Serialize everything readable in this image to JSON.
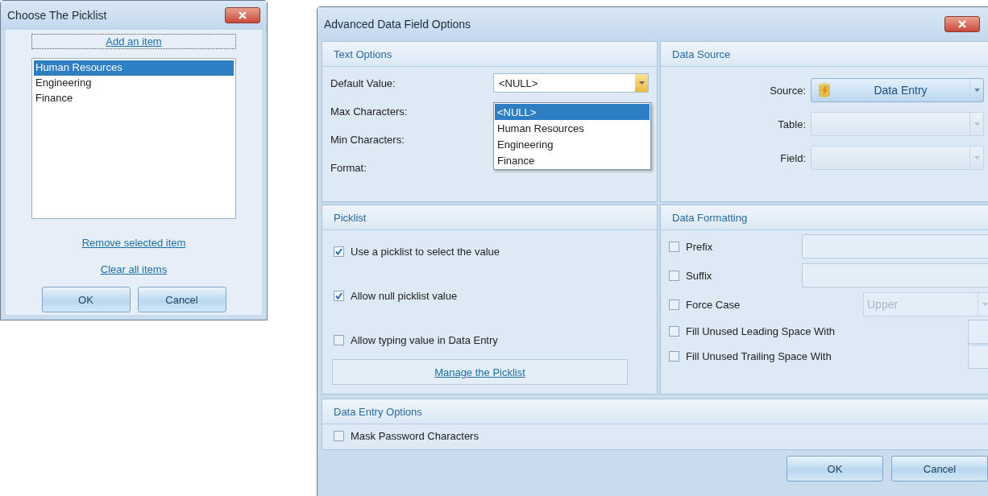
{
  "picklist_dialog": {
    "title": "Choose The Picklist",
    "add_link": "Add an item",
    "items": [
      {
        "label": "Human Resources",
        "selected": true
      },
      {
        "label": "Engineering",
        "selected": false
      },
      {
        "label": "Finance",
        "selected": false
      }
    ],
    "remove_link": "Remove selected item",
    "clear_link": "Clear all items",
    "buttons": [
      "OK",
      "Cancel"
    ]
  },
  "options_dialog": {
    "title": "Advanced Data Field Options",
    "text_options": {
      "heading": "Text Options",
      "default_label": "Default Value:",
      "default_value": "<NULL>",
      "dropdown_open": true,
      "dropdown": [
        {
          "label": "<NULL>",
          "selected": true
        },
        {
          "label": "Human Resources",
          "selected": false
        },
        {
          "label": "Engineering",
          "selected": false
        },
        {
          "label": "Finance",
          "selected": false
        }
      ],
      "other_labels": [
        "Max Characters:",
        "Min Characters:",
        "Format:"
      ]
    },
    "data_source": {
      "heading": "Data Source",
      "fields": [
        {
          "label": "Source:",
          "value": "Data Entry",
          "disabled": false
        },
        {
          "label": "Table:",
          "disabled": true
        },
        {
          "label": "Field:",
          "disabled": true
        }
      ]
    },
    "picklist": {
      "heading": "Picklist",
      "options": [
        {
          "label": "Use a picklist to select the value",
          "checked": true
        },
        {
          "label": "Allow null picklist value",
          "checked": true
        },
        {
          "label": "Allow typing value in Data Entry",
          "checked": false
        }
      ],
      "manage_link": "Manage the Picklist"
    },
    "data_formatting": {
      "heading": "Data Formatting",
      "rows": [
        {
          "kind": "text",
          "label": "Prefix",
          "checked": false
        },
        {
          "kind": "text",
          "label": "Suffix",
          "checked": false
        },
        {
          "kind": "combo",
          "label": "Force Case",
          "checked": false,
          "value": "Upper"
        },
        {
          "kind": "char",
          "label": "Fill Unused Leading Space With",
          "checked": false
        },
        {
          "kind": "char",
          "label": "Fill Unused Trailing Space With",
          "checked": false
        }
      ]
    },
    "data_entry_options": {
      "heading": "Data Entry Options",
      "options": [
        {
          "label": "Mask Password Characters",
          "checked": false
        }
      ]
    },
    "buttons": [
      "OK",
      "Cancel"
    ]
  }
}
